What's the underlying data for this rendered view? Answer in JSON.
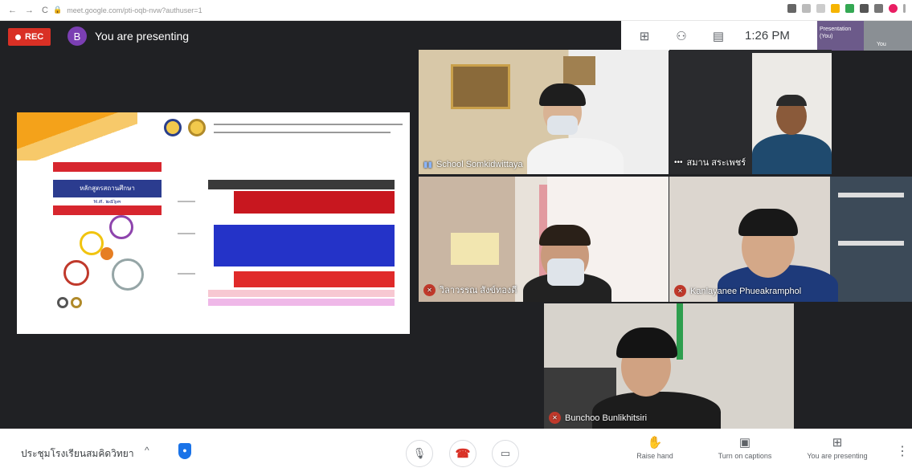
{
  "browser": {
    "nav_back": "←",
    "nav_forward": "→",
    "nav_reload": "C",
    "url": "meet.google.com/pti-oqb-nvw?authuser=1"
  },
  "meet": {
    "rec_label": "REC",
    "presenter_initial": "B",
    "presenting_banner": "You are presenting",
    "time": "1:26 PM",
    "self_tile_label": "Presentation (You)",
    "self_you_label": "You"
  },
  "participants": [
    {
      "name": "School Somkidwittaya"
    },
    {
      "name": "สมาน สระเพชร์"
    },
    {
      "name": "วิลาวรรณ สังข์ทองดี"
    },
    {
      "name": "Kanlayanee Phueakramphol"
    },
    {
      "name": "Bunchoo Bunlikhitsiri"
    }
  ],
  "slide": {
    "banner_text": "หลักสูตรสถานศึกษา",
    "banner_sub": "พ.ศ. ๒๕๖๓"
  },
  "bottom": {
    "meeting_name": "ประชุมโรงเรียนสมคิดวิทยา",
    "chevron": "^",
    "actions": {
      "raise_hand": "Raise hand",
      "captions": "Turn on captions",
      "presenting": "You are presenting"
    }
  },
  "colors": {
    "meet_bg": "#202124",
    "rec_red": "#d93025",
    "avatar_purple": "#7b3fb3",
    "hangup_red": "#d93025"
  }
}
